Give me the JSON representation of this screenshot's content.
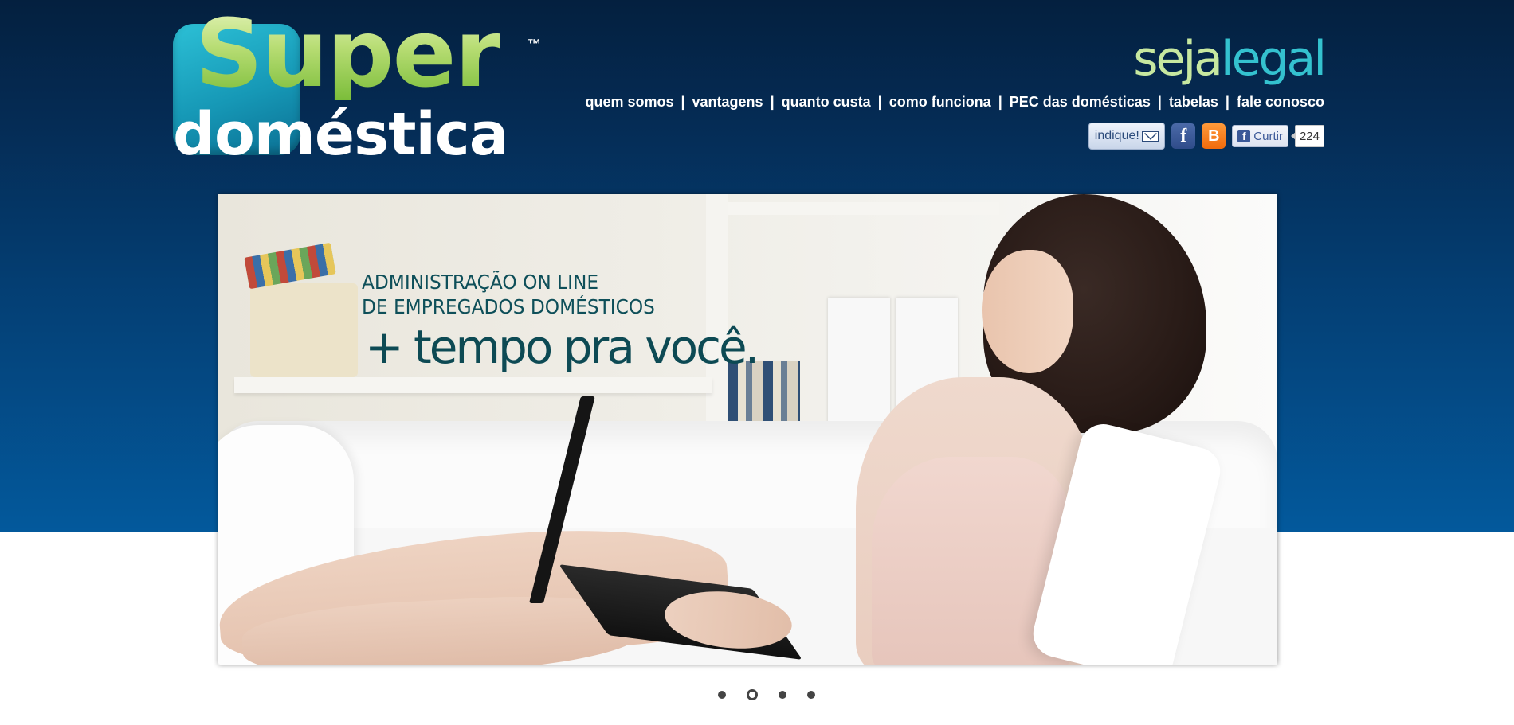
{
  "brand": {
    "logo_line1": "Super",
    "logo_line2": "doméstica",
    "trademark": "™",
    "slogan_part1": "seja",
    "slogan_part2": "legal"
  },
  "nav": {
    "items": [
      {
        "label": "quem somos"
      },
      {
        "label": "vantagens"
      },
      {
        "label": "quanto custa"
      },
      {
        "label": "como funciona"
      },
      {
        "label": "PEC das domésticas"
      },
      {
        "label": "tabelas"
      },
      {
        "label": "fale conosco"
      }
    ],
    "separator": "|"
  },
  "social": {
    "indique_label": "indique!",
    "facebook_glyph": "f",
    "blogger_glyph": "B",
    "curtir_label": "Curtir",
    "like_count": "224",
    "icons": [
      "envelope-icon",
      "facebook-icon",
      "blogger-icon"
    ]
  },
  "banner": {
    "headline_line1": "ADMINISTRAÇÃO ON LINE",
    "headline_line2": "DE EMPREGADOS DOMÉSTICOS",
    "tagline": "+ tempo pra você."
  },
  "carousel": {
    "slide_count": 4,
    "active_index": 1
  },
  "colors": {
    "header_dark": "#04203f",
    "header_light": "#03599c",
    "logo_green": "#a7d46a",
    "logo_teal": "#1698b6",
    "slogan_light": "#c7e8a0",
    "slogan_teal": "#34c2cf",
    "headline_teal": "#0e4f59"
  }
}
